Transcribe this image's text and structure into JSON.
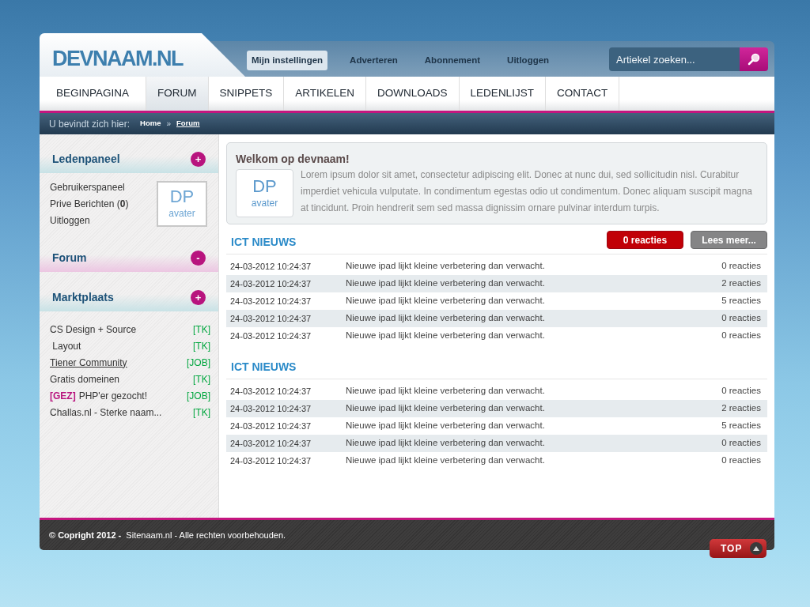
{
  "logo": "DEVNAAM.NL",
  "top_links": [
    {
      "label": "Mijn instellingen",
      "selected": true
    },
    {
      "label": "Adverteren",
      "selected": false
    },
    {
      "label": "Abonnement",
      "selected": false
    },
    {
      "label": "Uitloggen",
      "selected": false
    }
  ],
  "search": {
    "placeholder": "Artiekel zoeken..."
  },
  "nav": [
    {
      "label": "BEGINPAGINA",
      "selected": false
    },
    {
      "label": "FORUM",
      "selected": true
    },
    {
      "label": "SNIPPETS",
      "selected": false
    },
    {
      "label": "ARTIKELEN",
      "selected": false
    },
    {
      "label": "DOWNLOADS",
      "selected": false
    },
    {
      "label": "LEDENLIJST",
      "selected": false
    },
    {
      "label": "CONTACT",
      "selected": false
    }
  ],
  "breadcrumb": {
    "label": "U bevindt zich hier:",
    "separator": "»",
    "items": [
      {
        "label": "Home",
        "selected": false
      },
      {
        "label": "Forum",
        "selected": true
      }
    ]
  },
  "sidebar": [
    {
      "kind": "members",
      "title": "Ledenpaneel",
      "toggle": "+",
      "selected": false,
      "links": [
        "Gebruikerspaneel",
        "Prive Berichten (**0**)",
        "Uitloggen"
      ],
      "avatar": {
        "initials": "DP",
        "caption": "avater"
      }
    },
    {
      "kind": "empty",
      "title": "Forum",
      "toggle": "-",
      "selected": true
    },
    {
      "kind": "market",
      "title": "Marktplaats",
      "toggle": "+",
      "selected": false,
      "items": [
        {
          "title": "CS Design + Source",
          "tag": "[TK]",
          "hovered": false
        },
        {
          "title": " Layout",
          "tag": "[TK]",
          "hovered": false
        },
        {
          "title": "Tiener Community",
          "tag": "[JOB]",
          "hovered": true
        },
        {
          "title": "Gratis domeinen",
          "tag": "[TK]",
          "hovered": false
        },
        {
          "prefix": "[GEZ]",
          "title": "PHP'er gezocht!",
          "tag": "[JOB]",
          "hovered": false
        },
        {
          "title": "Challas.nl - Sterke naam...",
          "tag": "[TK]",
          "hovered": false
        }
      ]
    }
  ],
  "welcome": {
    "title": "Welkom op devnaam!",
    "avatar": {
      "initials": "DP",
      "caption": "avater"
    },
    "text": "Lorem ipsum dolor sit amet, consectetur adipiscing elit. Donec at nunc dui, sed sollicitudin nisl. Curabitur imperdiet vehicula vulputate. In condimentum egestas odio ut condimentum. Donec aliquam suscipit magna at tincidunt. Proin hendrerit sem sed massa dignissim ornare pulvinar interdum turpis."
  },
  "news_sections": [
    {
      "title": "ICT NIEUWS",
      "buttons": [
        {
          "kind": "comments",
          "label": "0 reacties"
        },
        {
          "kind": "more",
          "label": "Lees meer..."
        }
      ],
      "rows": [
        {
          "date": "24-03-2012 10:24:37",
          "title": "Nieuwe ipad lijkt kleine verbetering dan verwacht.",
          "reactions": "0 reacties"
        },
        {
          "date": "24-03-2012 10:24:37",
          "title": "Nieuwe ipad lijkt kleine verbetering dan verwacht.",
          "reactions": "2 reacties"
        },
        {
          "date": "24-03-2012 10:24:37",
          "title": "Nieuwe ipad lijkt kleine verbetering dan verwacht.",
          "reactions": "5 reacties"
        },
        {
          "date": "24-03-2012 10:24:37",
          "title": "Nieuwe ipad lijkt kleine verbetering dan verwacht.",
          "reactions": "0 reacties"
        },
        {
          "date": "24-03-2012 10:24:37",
          "title": "Nieuwe ipad lijkt kleine verbetering dan verwacht.",
          "reactions": "0 reacties"
        }
      ]
    },
    {
      "title": "ICT NIEUWS",
      "rows": [
        {
          "date": "24-03-2012 10:24:37",
          "title": "Nieuwe ipad lijkt kleine verbetering dan verwacht.",
          "reactions": "0 reacties"
        },
        {
          "date": "24-03-2012 10:24:37",
          "title": "Nieuwe ipad lijkt kleine verbetering dan verwacht.",
          "reactions": "2 reacties"
        },
        {
          "date": "24-03-2012 10:24:37",
          "title": "Nieuwe ipad lijkt kleine verbetering dan verwacht.",
          "reactions": "5 reacties"
        },
        {
          "date": "24-03-2012 10:24:37",
          "title": "Nieuwe ipad lijkt kleine verbetering dan verwacht.",
          "reactions": "0 reacties"
        },
        {
          "date": "24-03-2012 10:24:37",
          "title": "Nieuwe ipad lijkt kleine verbetering dan verwacht.",
          "reactions": "0 reacties"
        }
      ]
    }
  ],
  "footer": {
    "text": "**© Copright 2012 -**  Sitenaam.nl - Alle rechten voorbehouden.",
    "top_button": "TOP"
  }
}
